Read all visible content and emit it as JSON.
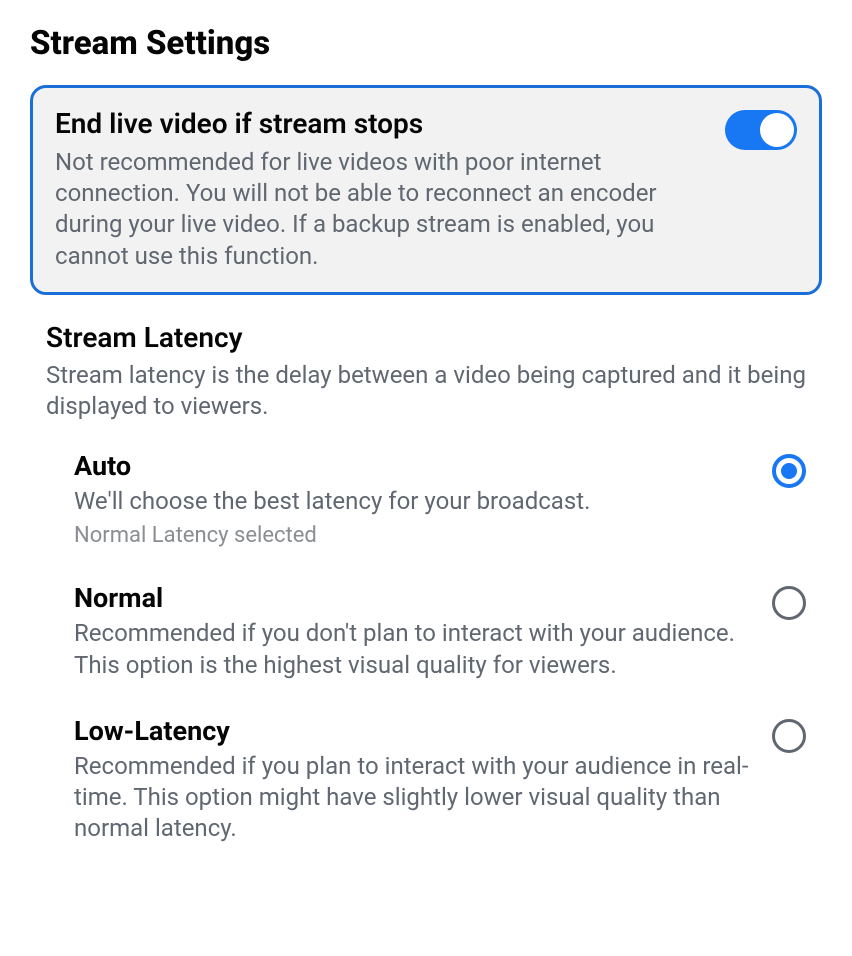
{
  "page": {
    "title": "Stream Settings"
  },
  "end_stream": {
    "title": "End live video if stream stops",
    "description": "Not recommended for live videos with poor internet connection. You will not be able to reconnect an encoder during your live video. If a backup stream is enabled, you cannot use this function.",
    "enabled": true
  },
  "latency": {
    "title": "Stream Latency",
    "description": "Stream latency is the delay between a video being captured and it being displayed to viewers.",
    "options": [
      {
        "title": "Auto",
        "description": "We'll choose the best latency for your broadcast.",
        "subtext": "Normal Latency selected",
        "selected": true
      },
      {
        "title": "Normal",
        "description": "Recommended if you don't plan to interact with your audience. This option is the highest visual quality for viewers.",
        "selected": false
      },
      {
        "title": "Low-Latency",
        "description": "Recommended if you plan to interact with your audience in real-time. This option might have slightly lower visual quality than normal latency.",
        "selected": false
      }
    ]
  }
}
